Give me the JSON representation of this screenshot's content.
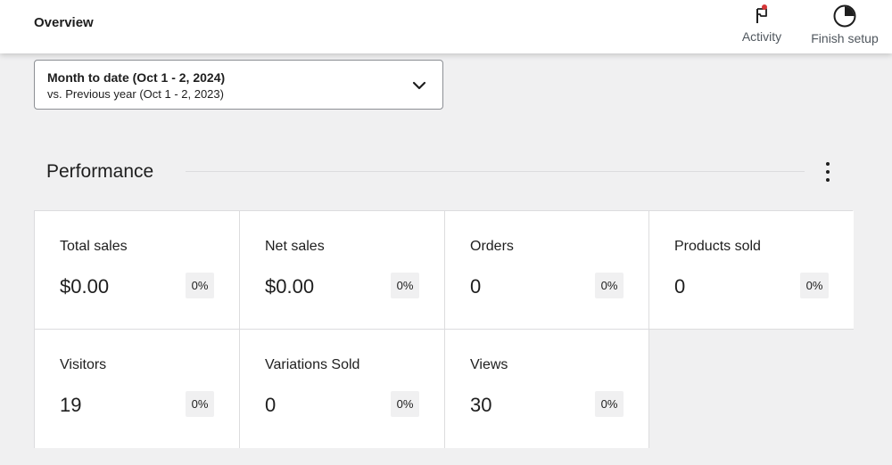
{
  "header": {
    "title": "Overview",
    "activity": {
      "label": "Activity",
      "icon": "flag-icon",
      "notification_color": "#d63638"
    },
    "finish_setup": {
      "label": "Finish setup",
      "icon": "progress-circle-icon"
    }
  },
  "date_range": {
    "primary": "Month to date (Oct 1 - 2, 2024)",
    "secondary": "vs. Previous year (Oct 1 - 2, 2023)",
    "icon": "chevron-down-icon"
  },
  "performance": {
    "title": "Performance",
    "menu_icon": "more-vertical-icon",
    "cards": [
      {
        "label": "Total sales",
        "value": "$0.00",
        "delta": "0%"
      },
      {
        "label": "Net sales",
        "value": "$0.00",
        "delta": "0%"
      },
      {
        "label": "Orders",
        "value": "0",
        "delta": "0%"
      },
      {
        "label": "Products sold",
        "value": "0",
        "delta": "0%"
      },
      {
        "label": "Visitors",
        "value": "19",
        "delta": "0%"
      },
      {
        "label": "Variations Sold",
        "value": "0",
        "delta": "0%"
      },
      {
        "label": "Views",
        "value": "30",
        "delta": "0%"
      }
    ]
  }
}
